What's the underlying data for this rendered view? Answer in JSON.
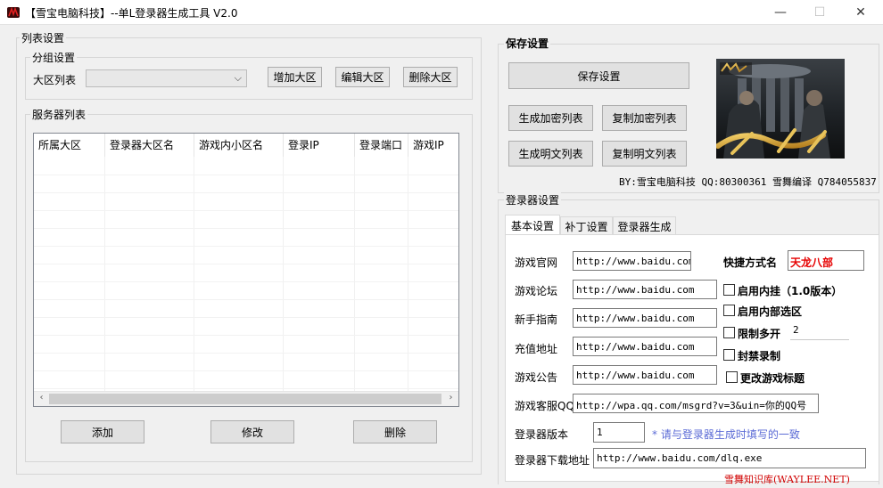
{
  "window": {
    "title": "【雪宝电脑科技】--单L登录器生成工具 V2.0",
    "minimize_glyph": "—",
    "maximize_glyph": "☐",
    "close_glyph": "✕"
  },
  "list_settings": {
    "title": "列表设置",
    "group_settings": {
      "title": "分组设置",
      "region_list_label": "大区列表",
      "region_select_value": "",
      "add_region": "增加大区",
      "edit_region": "编辑大区",
      "delete_region": "删除大区"
    },
    "server_list": {
      "title": "服务器列表",
      "columns": [
        "所属大区",
        "登录器大区名",
        "游戏内小区名",
        "登录IP",
        "登录端口",
        "游戏IP"
      ],
      "rows": []
    },
    "add_button": "添加",
    "modify_button": "修改",
    "delete_button": "删除"
  },
  "save_settings": {
    "title": "保存设置",
    "save_button": "保存设置",
    "gen_encrypted": "生成加密列表",
    "copy_encrypted": "复制加密列表",
    "gen_plain": "生成明文列表",
    "copy_plain": "复制明文列表",
    "banner_icon": "game-banner-image",
    "credit": "BY:雪宝电脑科技 QQ:80300361 雪舞编译 Q784055837"
  },
  "launcher_settings": {
    "title": "登录器设置",
    "tabs": [
      "基本设置",
      "补丁设置",
      "登录器生成"
    ],
    "fields": [
      {
        "label": "游戏官网",
        "value": "http://www.baidu.com"
      },
      {
        "label": "游戏论坛",
        "value": "http://www.baidu.com"
      },
      {
        "label": "新手指南",
        "value": "http://www.baidu.com"
      },
      {
        "label": "充值地址",
        "value": "http://www.baidu.com"
      },
      {
        "label": "游戏公告",
        "value": "http://www.baidu.com"
      },
      {
        "label": "游戏客服QQ",
        "value": "http://wpa.qq.com/msgrd?v=3&uin=你的QQ号"
      }
    ],
    "shortcut_label": "快捷方式名",
    "shortcut_value": "天龙八部",
    "checkboxes": [
      {
        "label": "启用内挂（1.0版本）",
        "checked": false
      },
      {
        "label": "启用内部选区",
        "checked": false
      },
      {
        "label": "限制多开",
        "checked": false
      },
      {
        "label": "封禁录制",
        "checked": false
      },
      {
        "label": "更改游戏标题",
        "checked": false
      }
    ],
    "multi_open_value": "2",
    "version_label": "登录器版本",
    "version_value": "1",
    "version_hint": "* 请与登录器生成时填写的一致",
    "download_label": "登录器下载地址",
    "download_value": "http://www.baidu.com/dlq.exe"
  },
  "watermark": "雪舞知识库(WAYLEE.NET)",
  "colors": {
    "accent_red": "#e60000",
    "hint_blue": "#5b6bd6",
    "window_bg": "#f0f0f0"
  }
}
